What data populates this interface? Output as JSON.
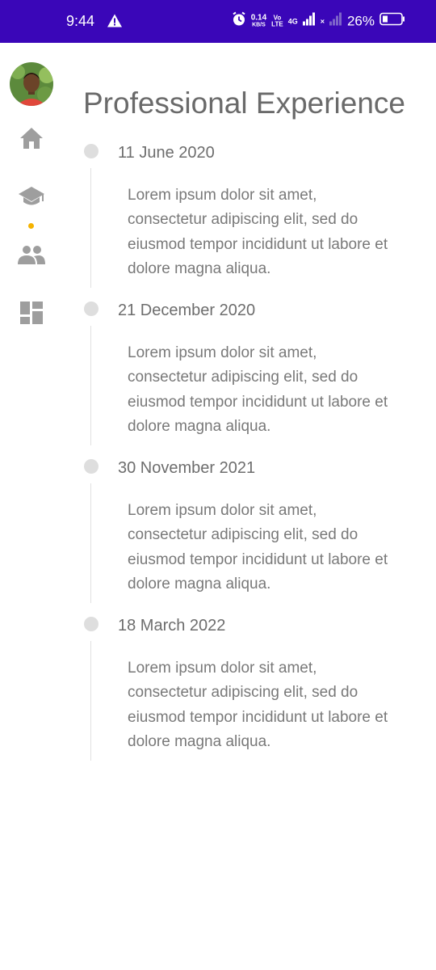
{
  "status_bar": {
    "time": "9:44",
    "net_speed_value": "0.14",
    "net_speed_unit": "KB/S",
    "volte_top": "Vo",
    "volte_bottom": "LTE",
    "network": "4G",
    "sim2_mark": "×",
    "battery": "26%"
  },
  "sidebar": {
    "items": [
      {
        "icon": "home-icon"
      },
      {
        "icon": "graduation-cap-icon",
        "active": true
      },
      {
        "icon": "people-icon"
      },
      {
        "icon": "dashboard-icon"
      }
    ],
    "active_indicator_color": "#f5b301"
  },
  "page": {
    "title": "Professional Experience"
  },
  "timeline": [
    {
      "date": "11 June 2020",
      "description": "Lorem ipsum dolor sit amet, consectetur adipiscing elit, sed do eiusmod tempor incididunt ut labore et dolore magna aliqua."
    },
    {
      "date": "21 December 2020",
      "description": "Lorem ipsum dolor sit amet, consectetur adipiscing elit, sed do eiusmod tempor incididunt ut labore et dolore magna aliqua."
    },
    {
      "date": "30 November 2021",
      "description": "Lorem ipsum dolor sit amet, consectetur adipiscing elit, sed do eiusmod tempor incididunt ut labore et dolore magna aliqua."
    },
    {
      "date": "18 March 2022",
      "description": "Lorem ipsum dolor sit amet, consectetur adipiscing elit, sed do eiusmod tempor incididunt ut labore et dolore magna aliqua."
    }
  ],
  "colors": {
    "status_bar": "#3a06b8",
    "accent": "#f5b301",
    "text_primary": "#6a6a6a",
    "icon_gray": "#9e9e9e"
  }
}
